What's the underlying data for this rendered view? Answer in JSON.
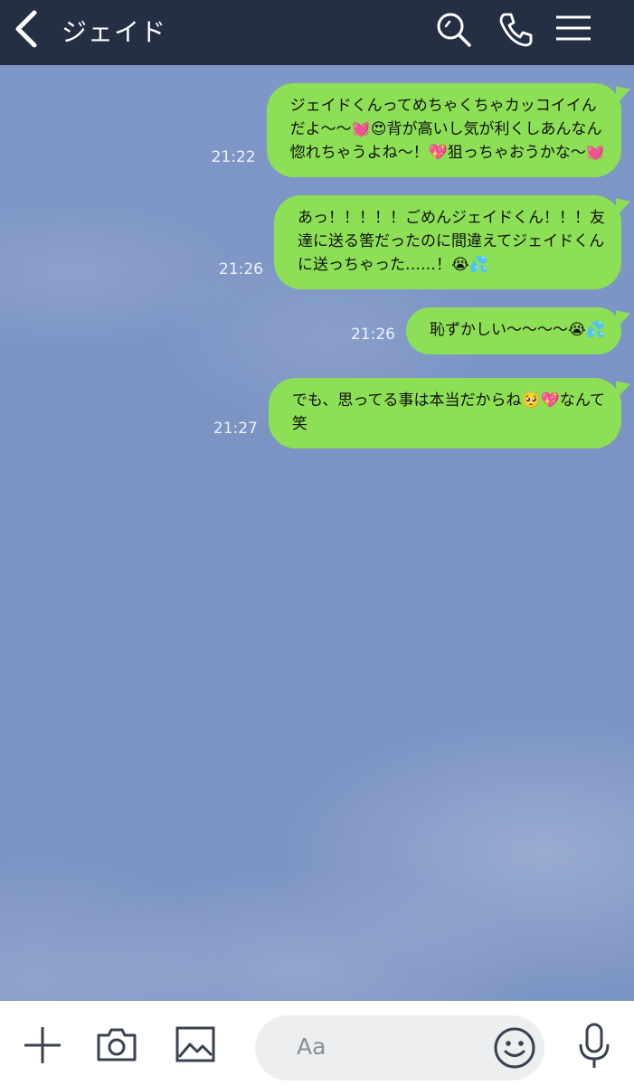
{
  "header": {
    "title": "ジェイド",
    "icons": [
      "back-chevron-icon",
      "search-icon",
      "phone-icon",
      "menu-icon"
    ]
  },
  "messages": [
    {
      "time": "21:22",
      "lines": [
        "ジェイドくんってめちゃくちゃカッコイイん",
        "だよ〜〜💓😍背が高いし気が利くしあんなん",
        "惚れちゃうよね〜！💖狙っちゃおうかな〜💓"
      ]
    },
    {
      "time": "21:26",
      "lines": [
        "あっ！！！！！ごめんジェイドくん！！！友",
        "達に送る筈だったのに間違えてジェイドくん",
        "に送っちゃった……！😭💦"
      ]
    },
    {
      "time": "21:26",
      "lines": [
        "恥ずかしい〜〜〜〜😭💦"
      ]
    },
    {
      "time": "21:27",
      "lines": [
        "でも、思ってる事は本当だからね🥺💖なんて",
        "笑"
      ]
    }
  ],
  "input": {
    "placeholder": "Aa",
    "icons": [
      "plus-icon",
      "camera-icon",
      "image-icon",
      "smiley-icon",
      "microphone-icon"
    ]
  },
  "colors": {
    "header_bg": "#242f43",
    "bubble_bg": "#8de055",
    "chat_bg": "#7f97c6",
    "input_field_bg": "#eceef0"
  }
}
